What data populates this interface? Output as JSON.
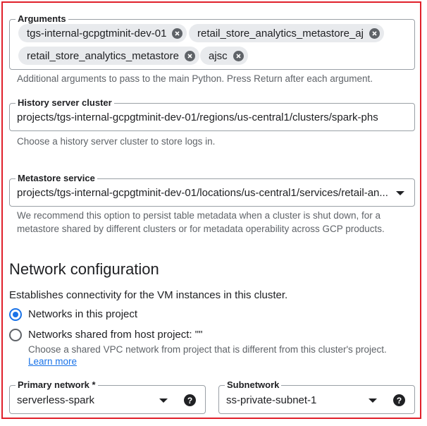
{
  "arguments": {
    "label": "Arguments",
    "chips": [
      "tgs-internal-gcpgtminit-dev-01",
      "retail_store_analytics_metastore_aj",
      "retail_store_analytics_metastore",
      "ajsc"
    ],
    "hint": "Additional arguments to pass to the main Python. Press Return after each argument."
  },
  "history_server": {
    "label": "History server cluster",
    "value": "projects/tgs-internal-gcpgtminit-dev-01/regions/us-central1/clusters/spark-phs",
    "hint": "Choose a history server cluster to store logs in."
  },
  "metastore": {
    "label": "Metastore service",
    "value": "projects/tgs-internal-gcpgtminit-dev-01/locations/us-central1/services/retail-an...",
    "hint_line1": "We recommend this option to persist table metadata when a cluster is shut down, for a",
    "hint_line2": "metastore shared by different clusters or for metadata operability across GCP products."
  },
  "network": {
    "title": "Network configuration",
    "description": "Establishes connectivity for the VM instances in this cluster.",
    "option_this_project": "Networks in this project",
    "option_shared": "Networks shared from host project: \"\"",
    "shared_hint": "Choose a shared VPC network from project that is different from this cluster's project.",
    "learn_more": "Learn more",
    "primary_network": {
      "label": "Primary network *",
      "value": "serverless-spark"
    },
    "subnetwork": {
      "label": "Subnetwork",
      "value": "ss-private-subnet-1"
    }
  },
  "help_glyph": "?",
  "colors": {
    "accent": "#1a73e8",
    "frame": "#e0202a",
    "chip_bg": "#e8eaed"
  }
}
